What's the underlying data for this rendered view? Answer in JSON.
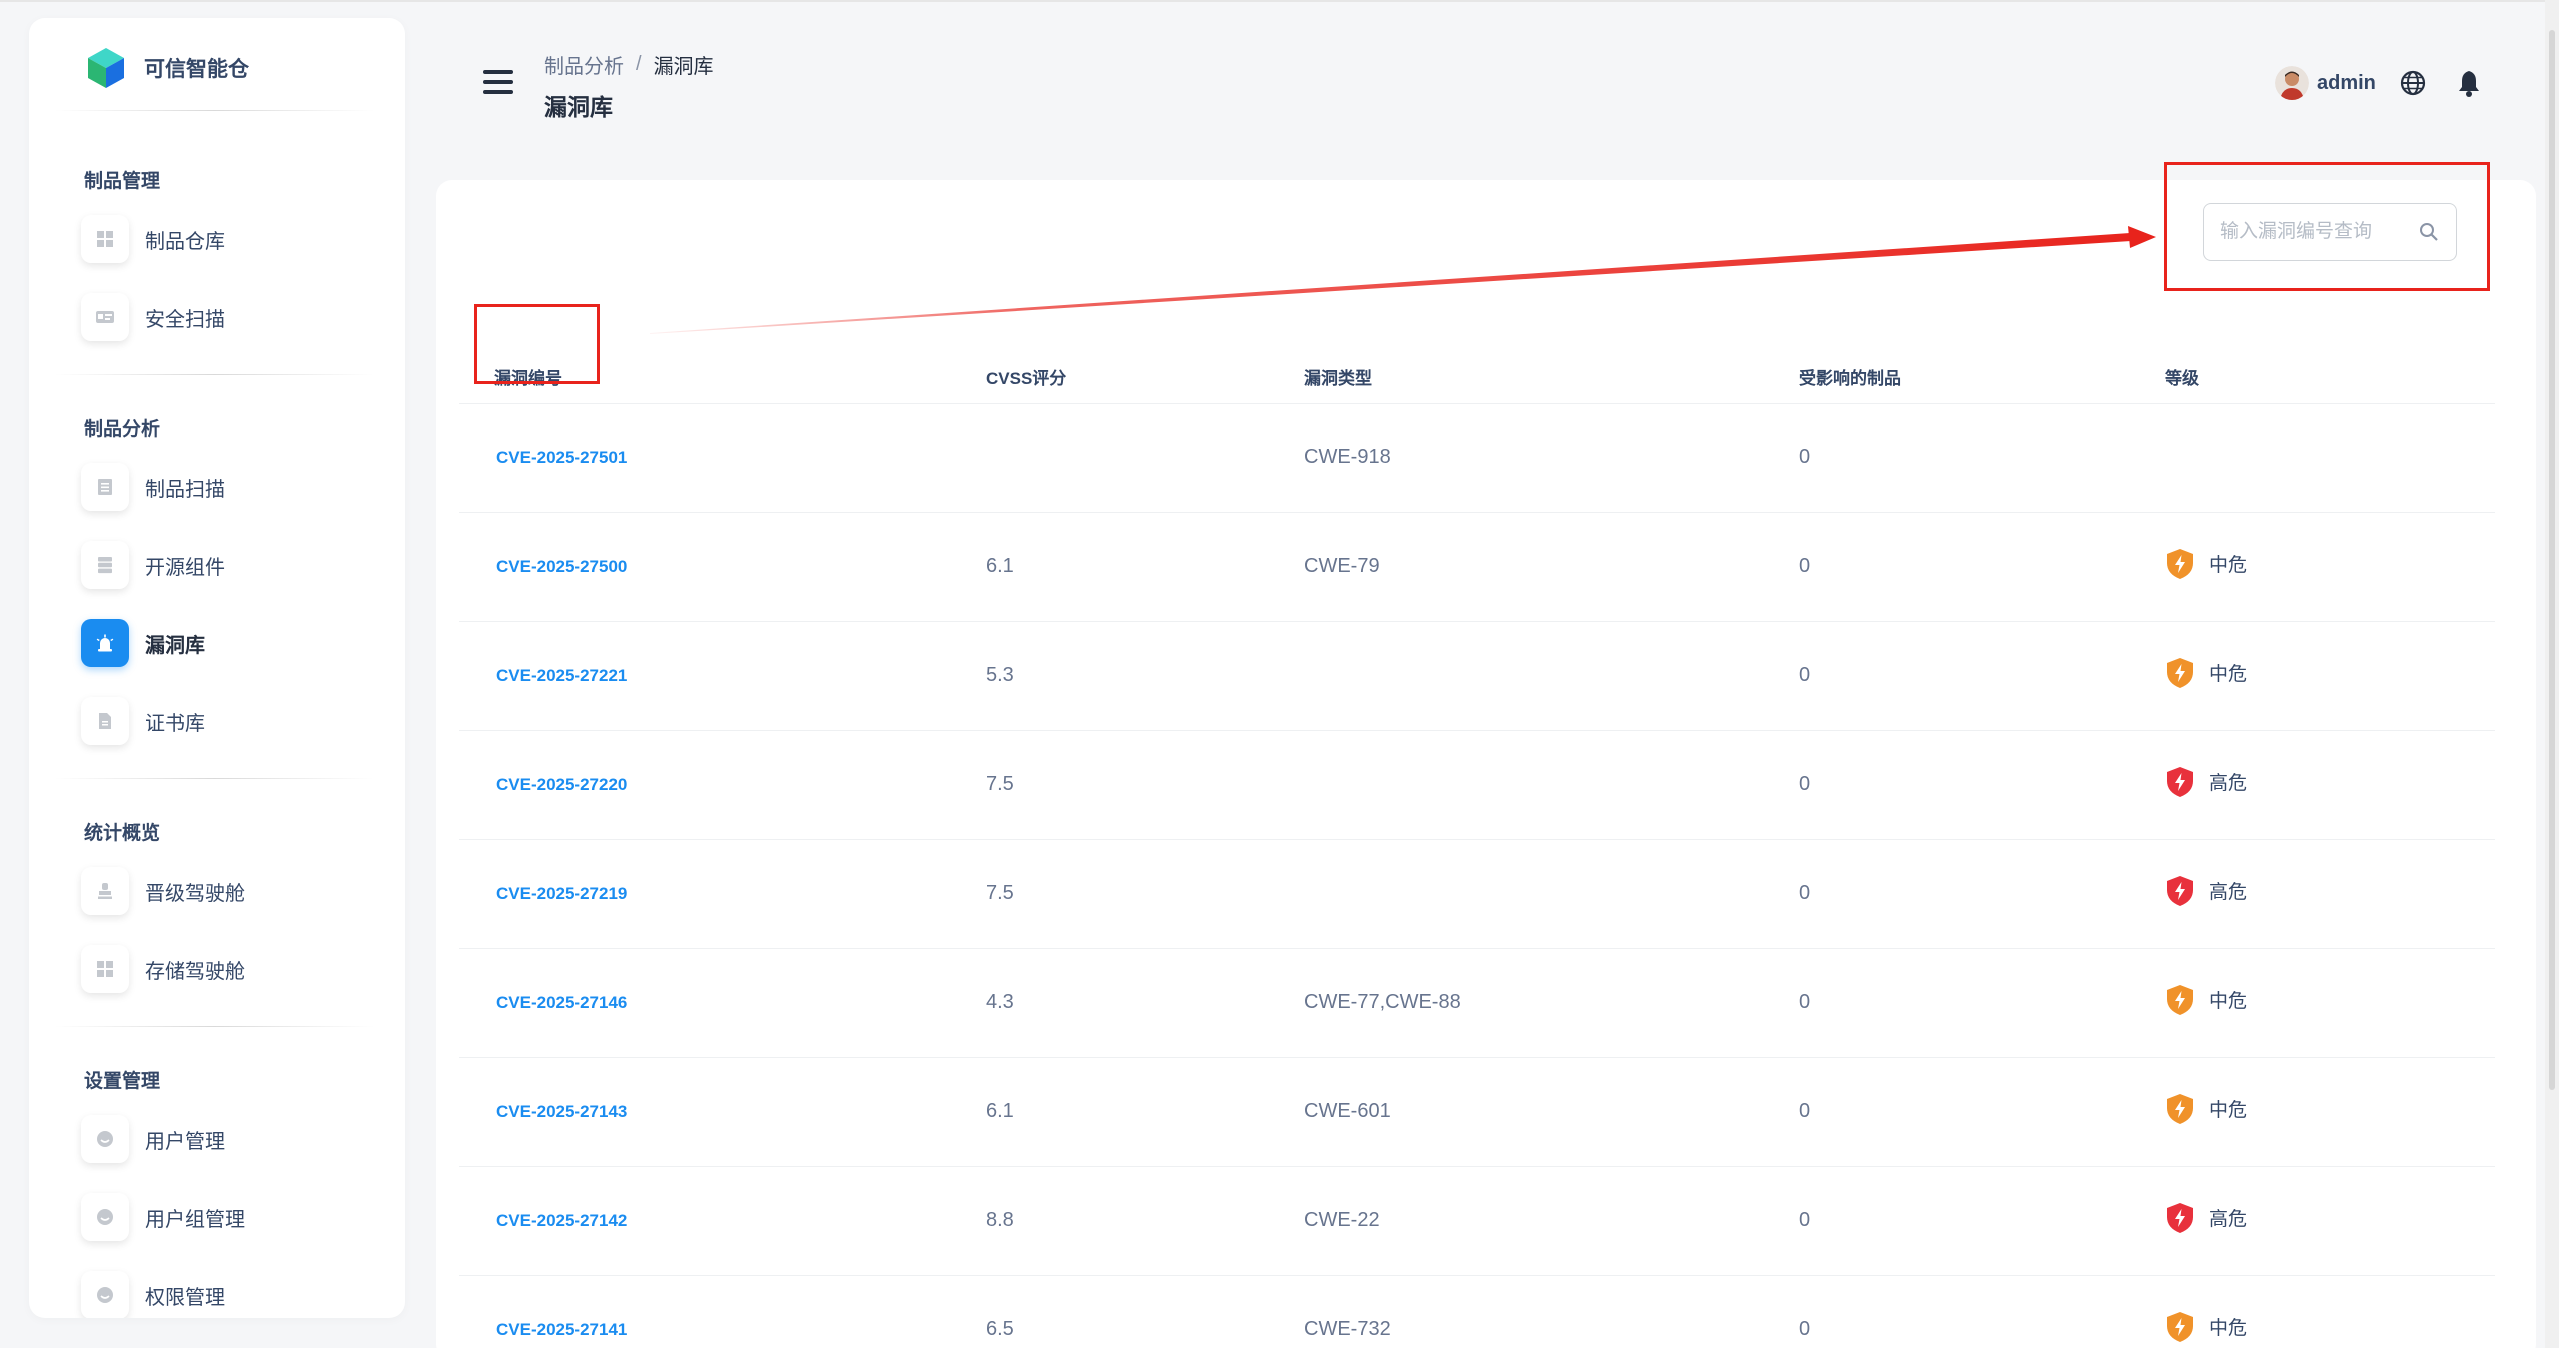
{
  "brand": {
    "name": "可信智能仓"
  },
  "sidebar": {
    "sections": [
      {
        "title": "制品管理",
        "items": [
          {
            "label": "制品仓库",
            "icon": "grid-icon"
          },
          {
            "label": "安全扫描",
            "icon": "id-card-icon"
          }
        ]
      },
      {
        "title": "制品分析",
        "items": [
          {
            "label": "制品扫描",
            "icon": "document-list-icon"
          },
          {
            "label": "开源组件",
            "icon": "server-icon"
          },
          {
            "label": "漏洞库",
            "icon": "alarm-light-icon",
            "active": true
          },
          {
            "label": "证书库",
            "icon": "file-icon"
          }
        ]
      },
      {
        "title": "统计概览",
        "items": [
          {
            "label": "晋级驾驶舱",
            "icon": "stamp-icon"
          },
          {
            "label": "存储驾驶舱",
            "icon": "grid-icon"
          }
        ]
      },
      {
        "title": "设置管理",
        "items": [
          {
            "label": "用户管理",
            "icon": "face-icon"
          },
          {
            "label": "用户组管理",
            "icon": "face-icon"
          },
          {
            "label": "权限管理",
            "icon": "face-icon"
          }
        ]
      }
    ]
  },
  "header": {
    "breadcrumb": {
      "parent": "制品分析",
      "separator": "/",
      "current": "漏洞库"
    },
    "title": "漏洞库",
    "user": "admin"
  },
  "search": {
    "placeholder": "输入漏洞编号查询",
    "value": ""
  },
  "table": {
    "columns": [
      "漏洞编号",
      "CVSS评分",
      "漏洞类型",
      "受影响的制品",
      "等级"
    ],
    "rows": [
      {
        "id": "CVE-2025-27501",
        "cvss": "",
        "type": "CWE-918",
        "affected": "0",
        "level": "",
        "severity": "none"
      },
      {
        "id": "CVE-2025-27500",
        "cvss": "6.1",
        "type": "CWE-79",
        "affected": "0",
        "level": "中危",
        "severity": "medium"
      },
      {
        "id": "CVE-2025-27221",
        "cvss": "5.3",
        "type": "",
        "affected": "0",
        "level": "中危",
        "severity": "medium"
      },
      {
        "id": "CVE-2025-27220",
        "cvss": "7.5",
        "type": "",
        "affected": "0",
        "level": "高危",
        "severity": "high"
      },
      {
        "id": "CVE-2025-27219",
        "cvss": "7.5",
        "type": "",
        "affected": "0",
        "level": "高危",
        "severity": "high"
      },
      {
        "id": "CVE-2025-27146",
        "cvss": "4.3",
        "type": "CWE-77,CWE-88",
        "affected": "0",
        "level": "中危",
        "severity": "medium"
      },
      {
        "id": "CVE-2025-27143",
        "cvss": "6.1",
        "type": "CWE-601",
        "affected": "0",
        "level": "中危",
        "severity": "medium"
      },
      {
        "id": "CVE-2025-27142",
        "cvss": "8.8",
        "type": "CWE-22",
        "affected": "0",
        "level": "高危",
        "severity": "high"
      },
      {
        "id": "CVE-2025-27141",
        "cvss": "6.5",
        "type": "CWE-732",
        "affected": "0",
        "level": "中危",
        "severity": "medium"
      }
    ]
  },
  "colors": {
    "accent": "#1a8cf0",
    "medium": "#f0922a",
    "high": "#e8313c",
    "annotation": "#e8231c"
  }
}
